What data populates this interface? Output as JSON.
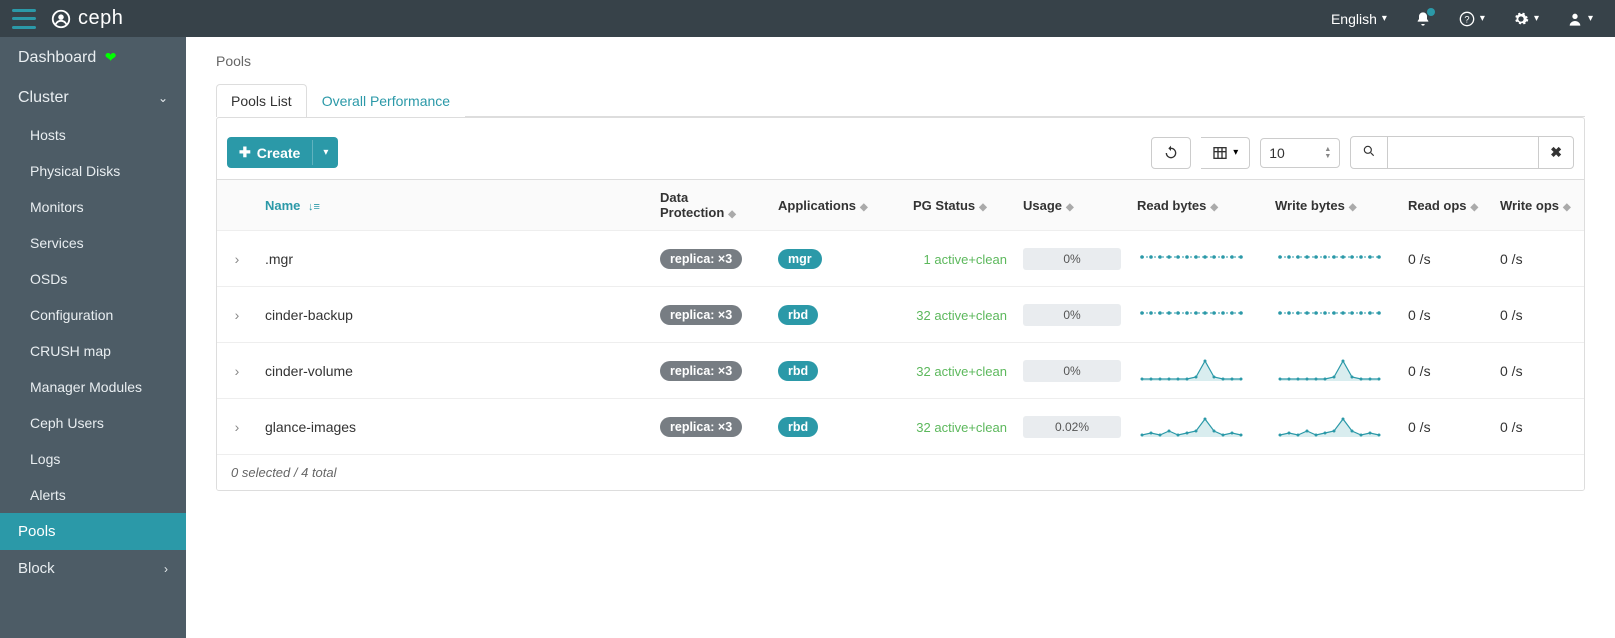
{
  "topbar": {
    "brand": "ceph",
    "language": "English"
  },
  "sidebar": {
    "dashboard_label": "Dashboard",
    "cluster_label": "Cluster",
    "items": [
      "Hosts",
      "Physical Disks",
      "Monitors",
      "Services",
      "OSDs",
      "Configuration",
      "CRUSH map",
      "Manager Modules",
      "Ceph Users",
      "Logs",
      "Alerts"
    ],
    "pools_label": "Pools",
    "block_label": "Block"
  },
  "breadcrumb": "Pools",
  "tabs": {
    "pools_list": "Pools List",
    "overall_performance": "Overall Performance"
  },
  "toolbar": {
    "create_label": "Create",
    "page_size": "10"
  },
  "columns": {
    "name": "Name",
    "data_protection": "Data Protection",
    "applications": "Applications",
    "pg_status": "PG Status",
    "usage": "Usage",
    "read_bytes": "Read bytes",
    "write_bytes": "Write bytes",
    "read_ops": "Read ops",
    "write_ops": "Write ops"
  },
  "rows": [
    {
      "name": ".mgr",
      "data_protection": "replica: ×3",
      "applications": "mgr",
      "pg_status": "1 active+clean",
      "usage": "0%",
      "read_ops": "0 /s",
      "write_ops": "0 /s",
      "spark_type": "flat"
    },
    {
      "name": "cinder-backup",
      "data_protection": "replica: ×3",
      "applications": "rbd",
      "pg_status": "32 active+clean",
      "usage": "0%",
      "read_ops": "0 /s",
      "write_ops": "0 /s",
      "spark_type": "flat"
    },
    {
      "name": "cinder-volume",
      "data_protection": "replica: ×3",
      "applications": "rbd",
      "pg_status": "32 active+clean",
      "usage": "0%",
      "read_ops": "0 /s",
      "write_ops": "0 /s",
      "spark_type": "peak"
    },
    {
      "name": "glance-images",
      "data_protection": "replica: ×3",
      "applications": "rbd",
      "pg_status": "32 active+clean",
      "usage": "0.02%",
      "read_ops": "0 /s",
      "write_ops": "0 /s",
      "spark_type": "wavy"
    }
  ],
  "footer": "0 selected / 4 total"
}
